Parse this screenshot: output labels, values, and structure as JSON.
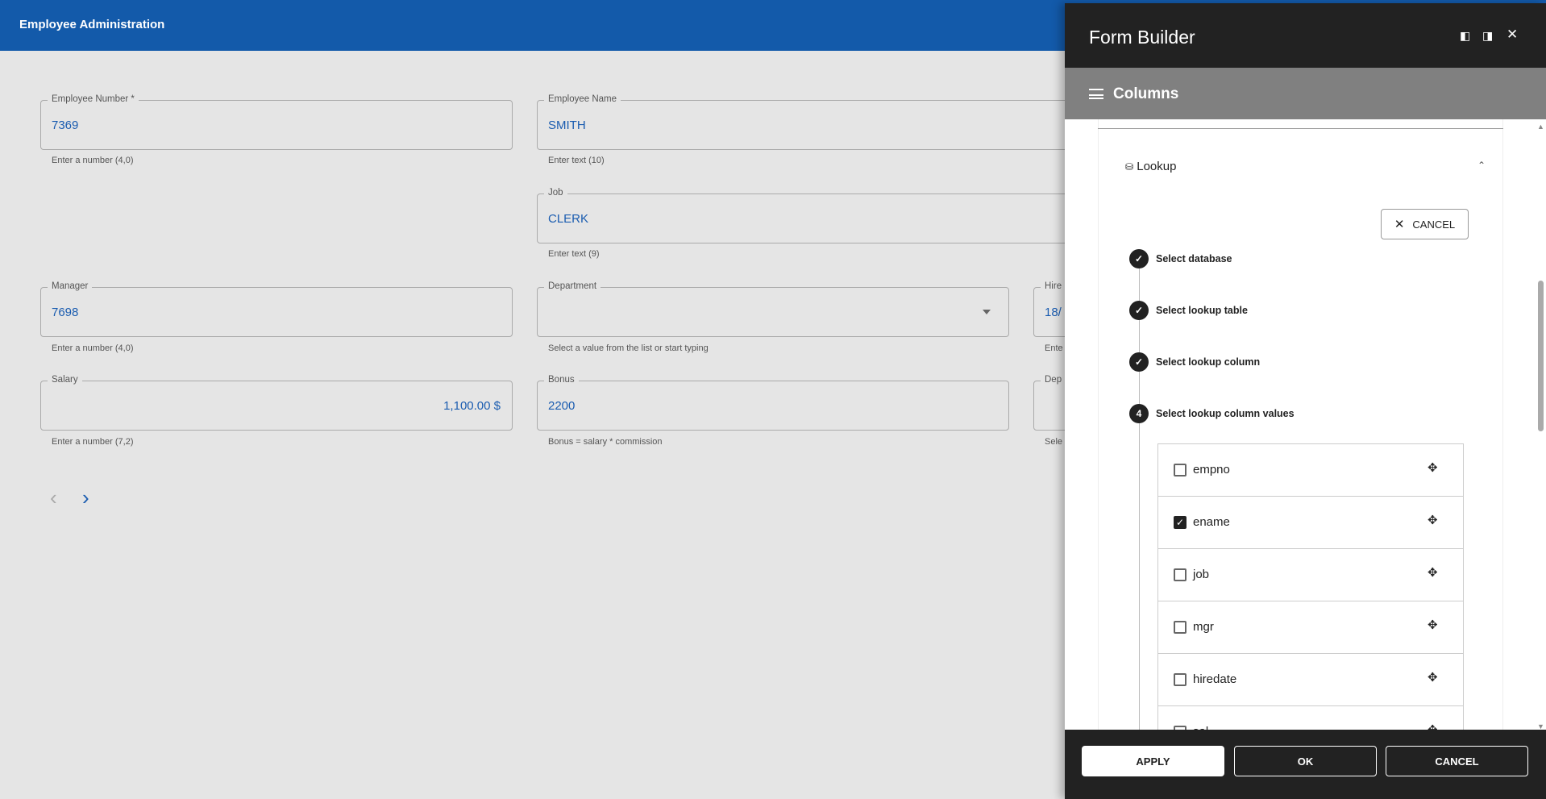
{
  "app": {
    "title": "Employee Administration"
  },
  "form": {
    "empno": {
      "label": "Employee Number *",
      "value": "7369",
      "helper": "Enter a number (4,0)"
    },
    "ename": {
      "label": "Employee Name",
      "value": "SMITH",
      "helper": "Enter text (10)"
    },
    "job": {
      "label": "Job",
      "value": "CLERK",
      "helper": "Enter text (9)"
    },
    "mgr": {
      "label": "Manager",
      "value": "7698",
      "helper": "Enter a number (4,0)"
    },
    "dept": {
      "label": "Department",
      "value": "",
      "helper": "Select a value from the list or start typing"
    },
    "hire": {
      "label": "Hire",
      "value": "18/",
      "helper": "Ente"
    },
    "sal": {
      "label": "Salary",
      "value": "1,100.00 $",
      "helper": "Enter a number (7,2)"
    },
    "bonus": {
      "label": "Bonus",
      "value": "2200",
      "helper": "Bonus = salary * commission"
    },
    "dep2": {
      "label": "Dep",
      "helper": "Sele"
    },
    "nav": {
      "prev": "‹",
      "next": "›"
    }
  },
  "panel": {
    "title": "Form Builder",
    "section": "Columns",
    "lookup": "Lookup",
    "cancel": "CANCEL",
    "steps": [
      {
        "label": "Select database",
        "badge": "✓"
      },
      {
        "label": "Select lookup table",
        "badge": "✓"
      },
      {
        "label": "Select lookup column",
        "badge": "✓"
      },
      {
        "label": "Select lookup column values",
        "badge": "4"
      }
    ],
    "columns": [
      {
        "name": "empno",
        "checked": false
      },
      {
        "name": "ename",
        "checked": true
      },
      {
        "name": "job",
        "checked": false
      },
      {
        "name": "mgr",
        "checked": false
      },
      {
        "name": "hiredate",
        "checked": false
      },
      {
        "name": "sal",
        "checked": false
      }
    ],
    "footer": {
      "apply": "APPLY",
      "ok": "OK",
      "cancel": "CANCEL"
    }
  }
}
